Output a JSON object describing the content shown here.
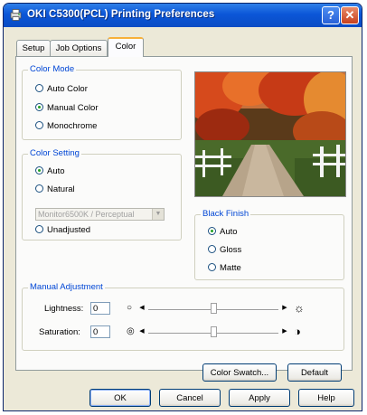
{
  "window": {
    "title": "OKI C5300(PCL) Printing Preferences",
    "help_label": "?",
    "close_label": "✕",
    "accent": "#0b56d8"
  },
  "tabs": [
    {
      "label": "Setup",
      "active": false
    },
    {
      "label": "Job Options",
      "active": false
    },
    {
      "label": "Color",
      "active": true
    }
  ],
  "color_mode": {
    "label": "Color Mode",
    "options": [
      {
        "label": "Auto Color",
        "selected": false
      },
      {
        "label": "Manual Color",
        "selected": true
      },
      {
        "label": "Monochrome",
        "selected": false
      }
    ]
  },
  "color_setting": {
    "label": "Color Setting",
    "options": [
      {
        "label": "Auto",
        "selected": true
      },
      {
        "label": "Natural",
        "selected": false
      },
      {
        "label": "Unadjusted",
        "selected": false
      }
    ],
    "profile_value": "Monitor6500K / Perceptual"
  },
  "preview": {
    "icon": "autumn-road-photo"
  },
  "black_finish": {
    "label": "Black Finish",
    "options": [
      {
        "label": "Auto",
        "selected": true
      },
      {
        "label": "Gloss",
        "selected": false
      },
      {
        "label": "Matte",
        "selected": false
      }
    ]
  },
  "manual_adjustment": {
    "label": "Manual Adjustment",
    "lightness": {
      "label": "Lightness:",
      "value": "0",
      "level": 0.5,
      "min_icon": "circle-icon",
      "max_icon": "sun-icon"
    },
    "saturation": {
      "label": "Saturation:",
      "value": "0",
      "level": 0.5,
      "min_icon": "swirl-icon",
      "max_icon": "contrast-icon"
    }
  },
  "buttons": {
    "color_swatch": "Color Swatch...",
    "default": "Default",
    "ok": "OK",
    "cancel": "Cancel",
    "apply": "Apply",
    "help": "Help"
  }
}
